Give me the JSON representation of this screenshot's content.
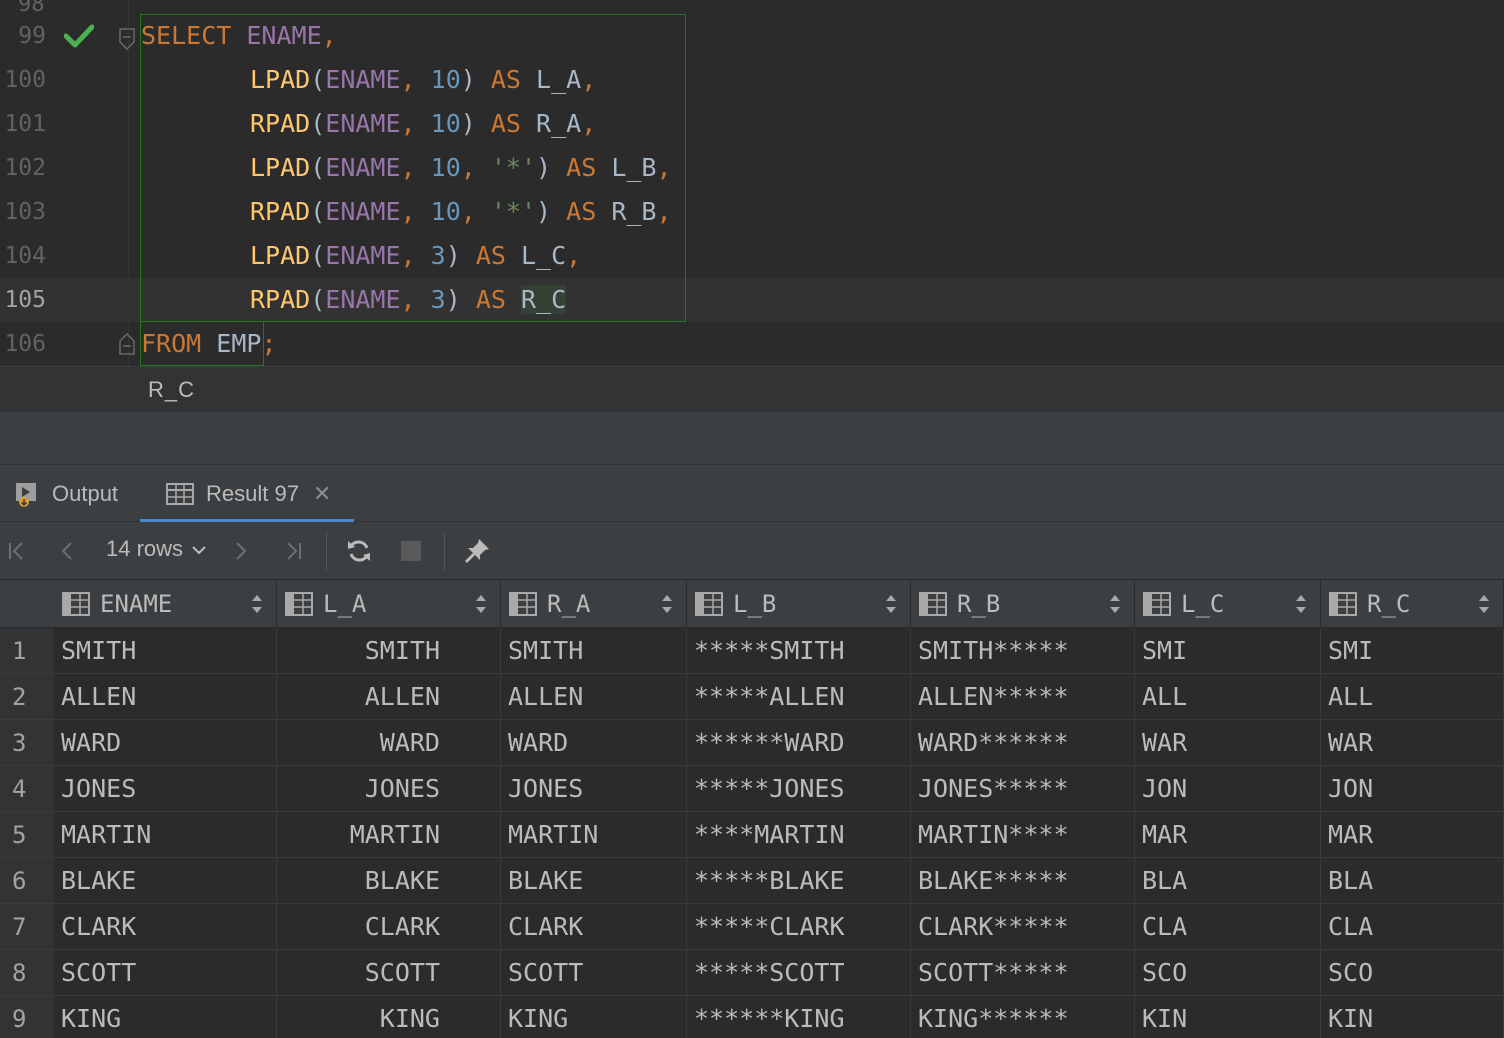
{
  "editor": {
    "lines": [
      {
        "num": "99"
      },
      {
        "num": "100"
      },
      {
        "num": "101"
      },
      {
        "num": "102"
      },
      {
        "num": "103"
      },
      {
        "num": "104"
      },
      {
        "num": "105"
      },
      {
        "num": "106"
      }
    ],
    "code": {
      "l99": {
        "kw": "SELECT",
        "col": "ENAME",
        "punct": ","
      },
      "l100": {
        "fn": "LPAD",
        "col": "ENAME",
        "n": "10",
        "kw": "AS",
        "alias": "L_A"
      },
      "l101": {
        "fn": "RPAD",
        "col": "ENAME",
        "n": "10",
        "kw": "AS",
        "alias": "R_A"
      },
      "l102": {
        "fn": "LPAD",
        "col": "ENAME",
        "n": "10",
        "str": "'*'",
        "kw": "AS",
        "alias": "L_B"
      },
      "l103": {
        "fn": "RPAD",
        "col": "ENAME",
        "n": "10",
        "str": "'*'",
        "kw": "AS",
        "alias": "R_B"
      },
      "l104": {
        "fn": "LPAD",
        "col": "ENAME",
        "n": "3",
        "kw": "AS",
        "alias": "L_C"
      },
      "l105": {
        "fn": "RPAD",
        "col": "ENAME",
        "n": "3",
        "kw": "AS",
        "alias": "R_C"
      },
      "l106": {
        "kw": "FROM",
        "table": "EMP",
        "punct": ";"
      }
    },
    "top_cut_number": "98"
  },
  "breadcrumb": "R_C",
  "tabs": {
    "output_label": "Output",
    "result_label": "Result 97",
    "close_glyph": "✕"
  },
  "toolbar": {
    "rows_label": "14 rows"
  },
  "grid": {
    "columns": [
      "ENAME",
      "L_A",
      "R_A",
      "L_B",
      "R_B",
      "L_C",
      "R_C"
    ],
    "rows": [
      {
        "n": "1",
        "c": [
          "SMITH",
          "SMITH",
          "SMITH",
          "*****SMITH",
          "SMITH*****",
          "SMI",
          "SMI"
        ]
      },
      {
        "n": "2",
        "c": [
          "ALLEN",
          "ALLEN",
          "ALLEN",
          "*****ALLEN",
          "ALLEN*****",
          "ALL",
          "ALL"
        ]
      },
      {
        "n": "3",
        "c": [
          "WARD",
          "WARD",
          "WARD",
          "******WARD",
          "WARD******",
          "WAR",
          "WAR"
        ]
      },
      {
        "n": "4",
        "c": [
          "JONES",
          "JONES",
          "JONES",
          "*****JONES",
          "JONES*****",
          "JON",
          "JON"
        ]
      },
      {
        "n": "5",
        "c": [
          "MARTIN",
          "MARTIN",
          "MARTIN",
          "****MARTIN",
          "MARTIN****",
          "MAR",
          "MAR"
        ]
      },
      {
        "n": "6",
        "c": [
          "BLAKE",
          "BLAKE",
          "BLAKE",
          "*****BLAKE",
          "BLAKE*****",
          "BLA",
          "BLA"
        ]
      },
      {
        "n": "7",
        "c": [
          "CLARK",
          "CLARK",
          "CLARK",
          "*****CLARK",
          "CLARK*****",
          "CLA",
          "CLA"
        ]
      },
      {
        "n": "8",
        "c": [
          "SCOTT",
          "SCOTT",
          "SCOTT",
          "*****SCOTT",
          "SCOTT*****",
          "SCO",
          "SCO"
        ]
      },
      {
        "n": "9",
        "c": [
          "KING",
          "KING",
          "KING",
          "******KING",
          "KING******",
          "KIN",
          "KIN"
        ]
      }
    ]
  },
  "colors": {
    "keyword": "#cc7832",
    "function": "#ffc66d",
    "column": "#9876aa",
    "number": "#6897bb",
    "string": "#6a8759",
    "success_check": "#4caf50",
    "selection_border": "#1f7a1f",
    "active_tab_underline": "#4a88c7"
  }
}
